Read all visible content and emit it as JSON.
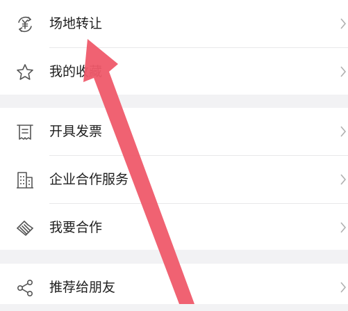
{
  "menu": {
    "group1": [
      {
        "id": "venue-transfer",
        "label": "场地转让",
        "icon": "yuan-cycle-icon"
      },
      {
        "id": "my-favorites",
        "label": "我的收藏",
        "icon": "star-icon"
      }
    ],
    "group2": [
      {
        "id": "issue-invoice",
        "label": "开具发票",
        "icon": "invoice-icon"
      },
      {
        "id": "enterprise-service",
        "label": "企业合作服务",
        "icon": "building-icon"
      },
      {
        "id": "cooperate",
        "label": "我要合作",
        "icon": "handshake-icon"
      }
    ],
    "group3": [
      {
        "id": "recommend",
        "label": "推荐给朋友",
        "icon": "share-icon"
      }
    ]
  },
  "colors": {
    "background": "#f2f2f4",
    "row_bg": "#ffffff",
    "icon_stroke": "#555555",
    "chevron": "#b0b0b0",
    "annotation_arrow": "#ef5a6a"
  }
}
